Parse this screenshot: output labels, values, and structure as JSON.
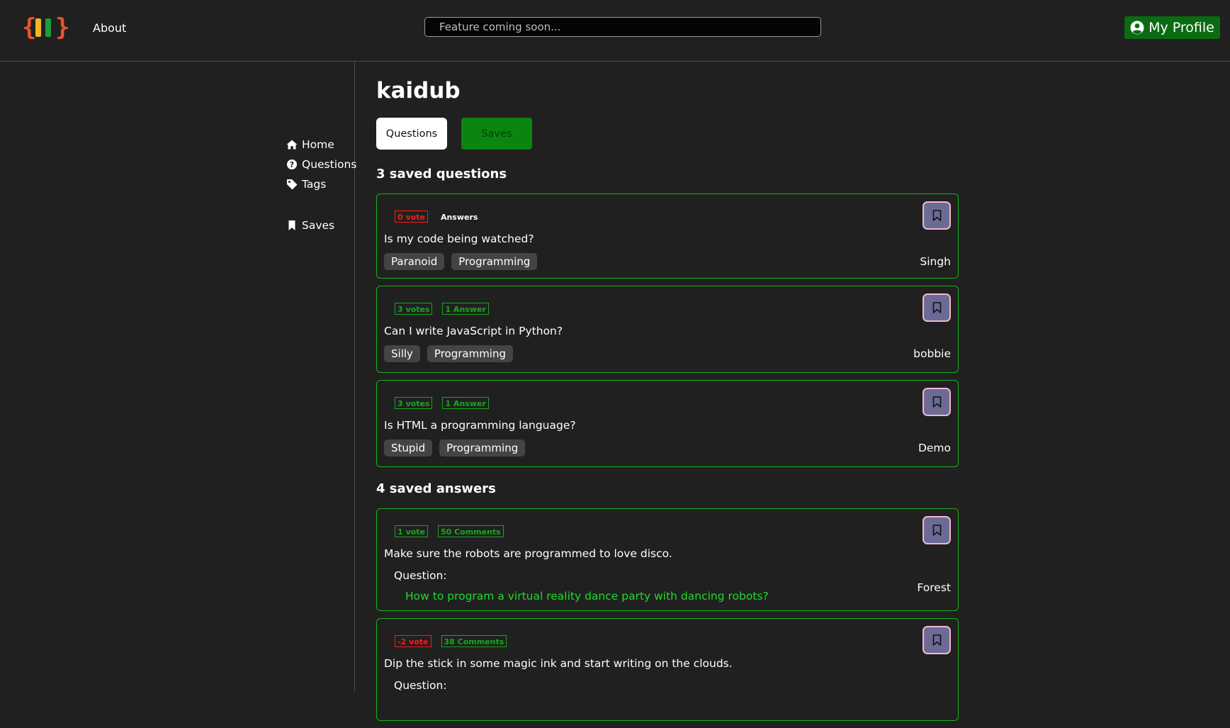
{
  "header": {
    "about_label": "About",
    "search_placeholder": "Feature coming soon...",
    "profile_label": "My Profile",
    "logo_colors": [
      "#e8542a",
      "#f0b42a",
      "#1f9e3a"
    ]
  },
  "sidebar": {
    "items": [
      {
        "label": "Home",
        "icon": "home-icon"
      },
      {
        "label": "Questions",
        "icon": "question-circle-icon"
      },
      {
        "label": "Tags",
        "icon": "tag-icon"
      }
    ],
    "saves_label": "Saves"
  },
  "main": {
    "username": "kaidub",
    "tabs": {
      "questions": "Questions",
      "saves": "Saves"
    },
    "saved_questions_title": "3 saved questions",
    "questions": [
      {
        "votes": "0 vote",
        "votes_color": "red",
        "answers": "Answers",
        "answers_style": "plain",
        "title": "Is my code being watched?",
        "tags": [
          "Paranoid",
          "Programming"
        ],
        "author": "Singh"
      },
      {
        "votes": "3 votes",
        "votes_color": "green",
        "answers": "1 Answer",
        "answers_style": "green",
        "title": "Can I write JavaScript in Python?",
        "tags": [
          "Silly",
          "Programming"
        ],
        "author": "bobbie"
      },
      {
        "votes": "3 votes",
        "votes_color": "green",
        "answers": "1 Answer",
        "answers_style": "green",
        "title": "Is HTML a programming language?",
        "tags": [
          "Stupid",
          "Programming"
        ],
        "author": "Demo"
      }
    ],
    "saved_answers_title": "4 saved answers",
    "answers": [
      {
        "votes": "1 vote",
        "votes_color": "green",
        "comments": "50 Comments",
        "text": "Make sure the robots are programmed to love disco.",
        "question_label": "Question:",
        "question_link": "How to program a virtual reality dance party with dancing robots?",
        "author": "Forest"
      },
      {
        "votes": "-2 vote",
        "votes_color": "red",
        "comments": "38 Comments",
        "text": "Dip the stick in some magic ink and start writing on the clouds.",
        "question_label": "Question:"
      }
    ]
  },
  "colors": {
    "background": "#202020",
    "accent_green": "#16b11e",
    "vote_red": "#ff1a1a",
    "save_button_fill": "#6b6b95",
    "save_button_border": "#f2b8cf",
    "profile_button": "#0b6b12"
  }
}
